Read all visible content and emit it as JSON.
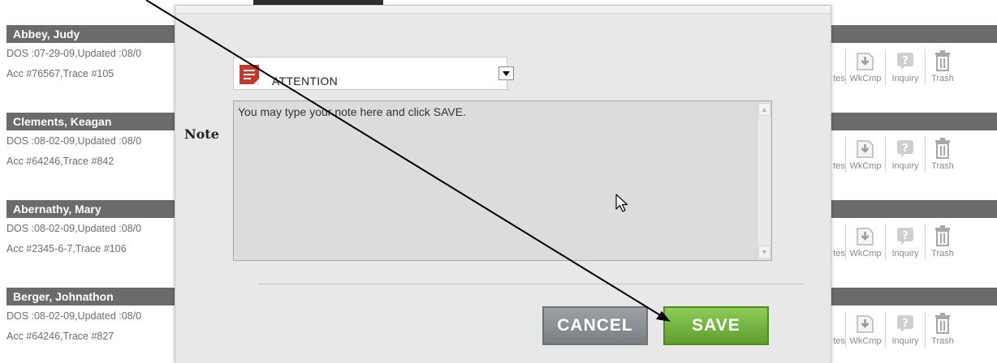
{
  "patients": [
    {
      "name": "Abbey, Judy",
      "line1": "DOS :07-29-09,Updated :08/0",
      "line2": "Acc #76567,Trace #105"
    },
    {
      "name": "Clements, Keagan",
      "line1": "DOS :08-02-09,Updated :08/0",
      "line2": "Acc #64246,Trace #842"
    },
    {
      "name": "Abernathy, Mary",
      "line1": "DOS :08-02-09,Updated :08/0",
      "line2": "Acc #2345-6-7,Trace #106"
    },
    {
      "name": "Berger, Johnathon",
      "line1": "DOS :08-02-09,Updated :08/0",
      "line2": "Acc #64246,Trace #827"
    }
  ],
  "actions": {
    "notes": "tes",
    "wkcmp": "WkCmp",
    "inquiry": "Inquiry",
    "trash": "Trash"
  },
  "dialog": {
    "note_type": "ATTENTION",
    "note_label": "Note",
    "note_text": "You may type your note here and click SAVE.",
    "cancel_label": "CANCEL",
    "save_label": "SAVE"
  },
  "colors": {
    "patient_bar": "#6b6b6b",
    "save_green": "#6fae3a",
    "cancel_gray": "#8c9094",
    "note_icon_red": "#c0392b"
  }
}
